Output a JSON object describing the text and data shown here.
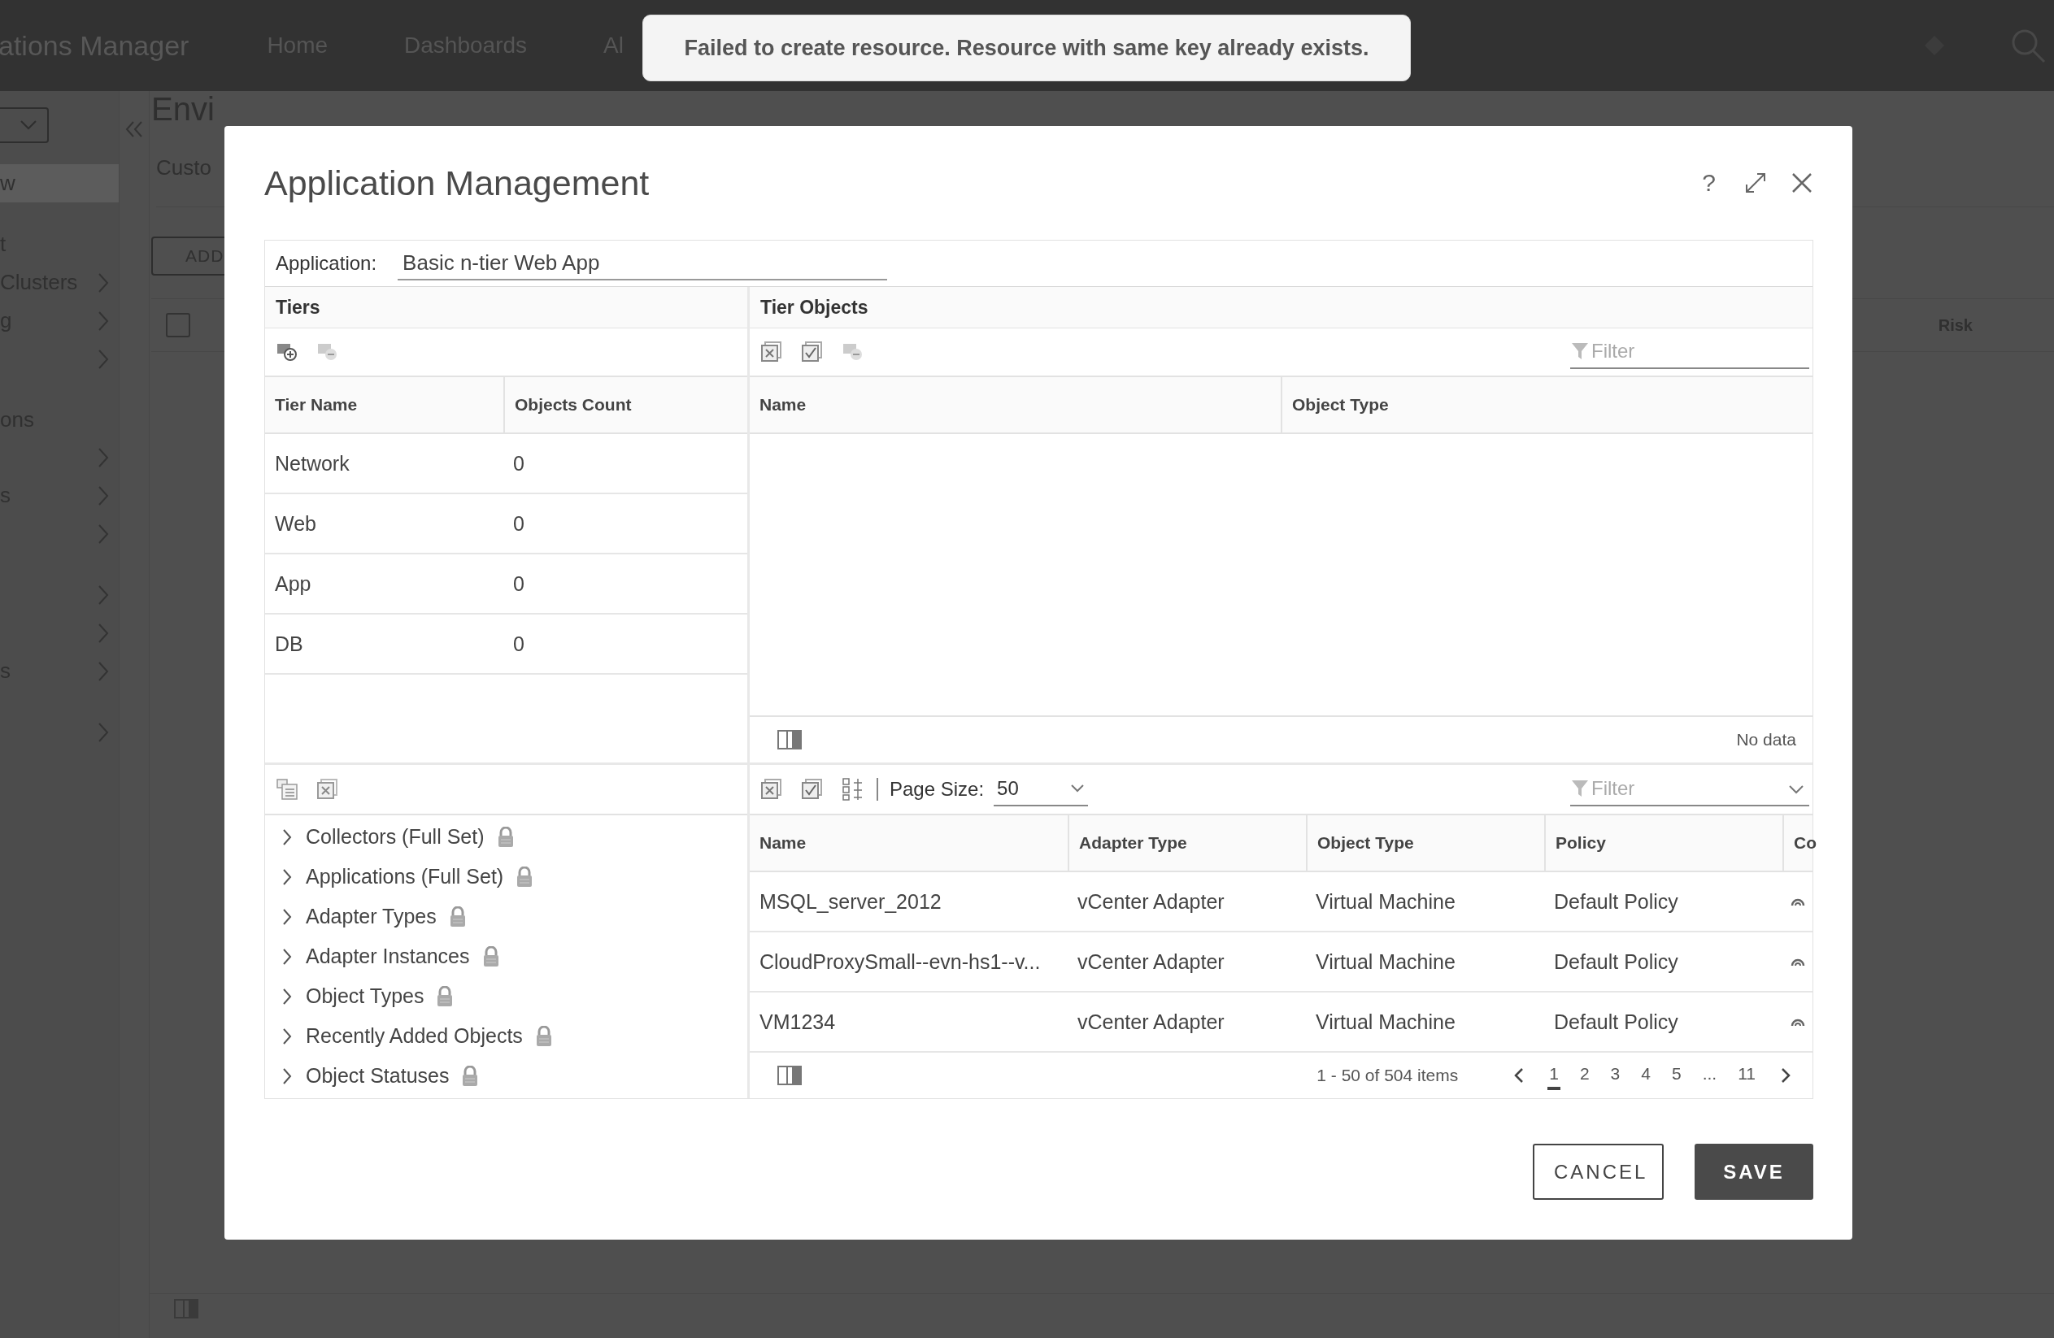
{
  "app_header": {
    "brand": "ations Manager",
    "nav": [
      "Home",
      "Dashboards",
      "Al"
    ]
  },
  "sidebar": {
    "sections": [
      {
        "items": [
          {
            "label": "w",
            "selected": true
          }
        ]
      },
      {
        "items": [
          {
            "label": "t",
            "selected": false
          },
          {
            "label": "Clusters",
            "selected": false,
            "expandable": true
          },
          {
            "label": "g",
            "selected": false,
            "expandable": true
          },
          {
            "selected": false,
            "expandable": true
          }
        ]
      },
      {
        "header": "ons",
        "items": [
          {
            "selected": false,
            "expandable": true
          },
          {
            "label": "s",
            "selected": false,
            "expandable": true
          },
          {
            "selected": false,
            "expandable": true
          }
        ]
      },
      {
        "items": [
          {
            "selected": false,
            "expandable": true
          },
          {
            "selected": false,
            "expandable": true
          },
          {
            "label": "s",
            "selected": false,
            "expandable": true
          }
        ]
      },
      {
        "items": [
          {
            "selected": false,
            "expandable": true
          }
        ]
      }
    ]
  },
  "page": {
    "title": "Envi",
    "tab": "Custo",
    "add_button": "ADD",
    "select_all_checked": false,
    "risk_column": "Risk"
  },
  "toast": {
    "message": "Failed to create resource. Resource with same key already exists."
  },
  "dialog": {
    "title": "Application Management",
    "help": "?",
    "application": {
      "label": "Application:",
      "value": "Basic n-tier Web App"
    },
    "tiers": {
      "title": "Tiers",
      "columns": [
        "Tier Name",
        "Objects Count"
      ],
      "rows": [
        {
          "name": "Network",
          "count": "0"
        },
        {
          "name": "Web",
          "count": "0"
        },
        {
          "name": "App",
          "count": "0"
        },
        {
          "name": "DB",
          "count": "0"
        }
      ]
    },
    "tier_objects": {
      "title": "Tier Objects",
      "filter_placeholder": "Filter",
      "columns": [
        "Name",
        "Object Type"
      ],
      "empty_text": "No data"
    },
    "tree": [
      {
        "label": "Collectors (Full Set)",
        "locked": true,
        "expanded": false
      },
      {
        "label": "Applications (Full Set)",
        "locked": true,
        "expanded": false
      },
      {
        "label": "Adapter Types",
        "locked": true,
        "expanded": false
      },
      {
        "label": "Adapter Instances",
        "locked": true,
        "expanded": false
      },
      {
        "label": "Object Types",
        "locked": true,
        "expanded": false
      },
      {
        "label": "Recently Added Objects",
        "locked": true,
        "expanded": false
      },
      {
        "label": "Object Statuses",
        "locked": true,
        "expanded": false
      }
    ],
    "objects": {
      "page_size_label": "Page Size:",
      "page_size": "50",
      "filter_placeholder": "Filter",
      "columns": [
        "Name",
        "Adapter Type",
        "Object Type",
        "Policy",
        "Co"
      ],
      "rows": [
        {
          "name": "MSQL_server_2012",
          "adapter_type": "vCenter Adapter",
          "object_type": "Virtual Machine",
          "policy": "Default Policy"
        },
        {
          "name": "CloudProxySmall--evn-hs1--v...",
          "adapter_type": "vCenter Adapter",
          "object_type": "Virtual Machine",
          "policy": "Default Policy"
        },
        {
          "name": "VM1234",
          "adapter_type": "vCenter Adapter",
          "object_type": "Virtual Machine",
          "policy": "Default Policy"
        }
      ],
      "summary": "1 - 50 of 504 items",
      "pages": [
        {
          "label": "1",
          "selected": true
        },
        {
          "label": "2",
          "selected": false
        },
        {
          "label": "3",
          "selected": false
        },
        {
          "label": "4",
          "selected": false
        },
        {
          "label": "5",
          "selected": false
        },
        {
          "label": "...",
          "selected": false
        },
        {
          "label": "11",
          "selected": false
        }
      ]
    },
    "buttons": [
      {
        "label": "CANCEL",
        "kind": "secondary"
      },
      {
        "label": "SAVE",
        "kind": "primary"
      }
    ]
  }
}
